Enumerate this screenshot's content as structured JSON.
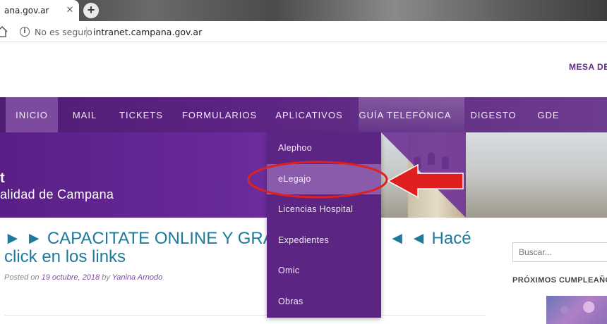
{
  "browser": {
    "tab_title": "ana.gov.ar",
    "tab_close": "✕",
    "new_tab": "+",
    "security_text": "No es seguro",
    "url": "intranet.campana.gov.ar"
  },
  "header": {
    "link_label": "MESA DE"
  },
  "nav": {
    "items": [
      {
        "label": "INICIO",
        "active": true
      },
      {
        "label": "MAIL"
      },
      {
        "label": "TICKETS"
      },
      {
        "label": "FORMULARIOS"
      },
      {
        "label": "APLICATIVOS"
      },
      {
        "label": "GUÍA TELEFÓNICA"
      },
      {
        "label": "DIGESTO"
      },
      {
        "label": "GDE"
      }
    ]
  },
  "banner": {
    "title": "t",
    "subtitle": "alidad de Campana"
  },
  "dropdown": {
    "items": [
      {
        "label": "Alephoo"
      },
      {
        "label": "eLegajo",
        "highlighted": true
      },
      {
        "label": "Licencias Hospital"
      },
      {
        "label": "Expedientes"
      },
      {
        "label": "Omic"
      },
      {
        "label": "Obras"
      }
    ]
  },
  "post": {
    "title_left": "► ► CAPACITATE ONLINE Y GRA",
    "title_right": "◄ ◄ Hacé",
    "title_line2": "click en los links",
    "meta_posted": "Posted on ",
    "meta_date": "19 octubre, 2018",
    "meta_by": " by ",
    "meta_author": "Yanina Arnodo"
  },
  "sidebar": {
    "search_placeholder": "Buscar...",
    "widget_title": "PRÓXIMOS CUMPLEAÑOS"
  },
  "colors": {
    "brand_purple": "#5c2483",
    "post_title": "#1e7a9c",
    "annotation_red": "#e02020"
  }
}
